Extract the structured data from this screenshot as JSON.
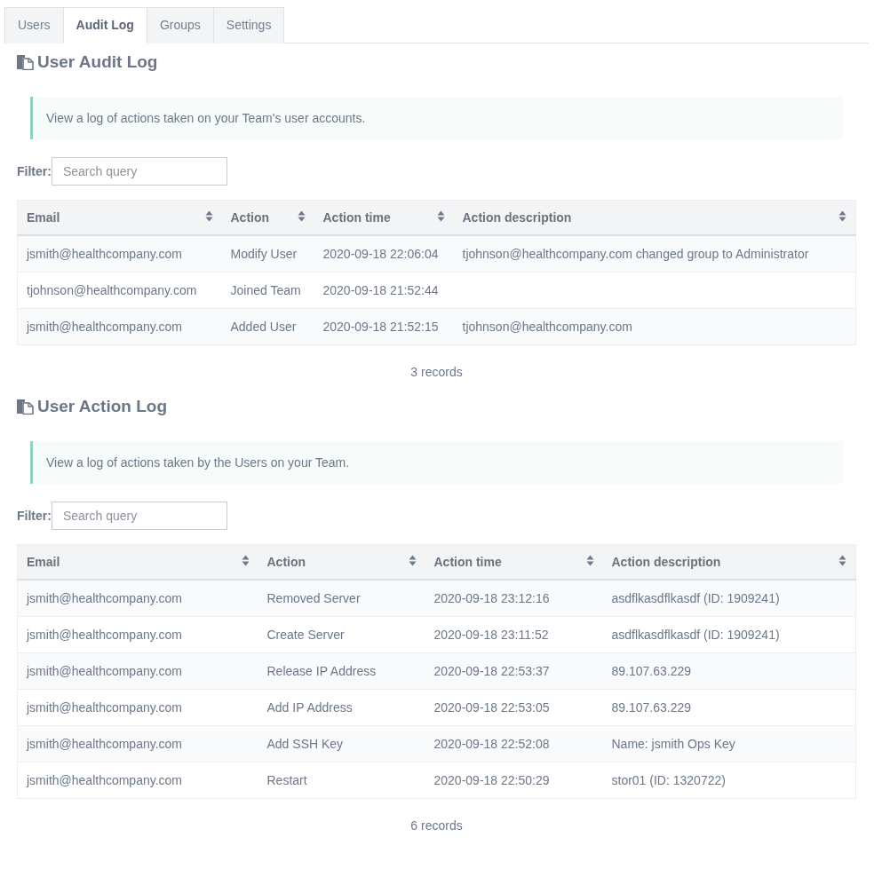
{
  "tabs": [
    {
      "label": "Users",
      "selected": false
    },
    {
      "label": "Audit Log",
      "selected": true
    },
    {
      "label": "Groups",
      "selected": false
    },
    {
      "label": "Settings",
      "selected": false
    }
  ],
  "sections": [
    {
      "title": "User Audit Log",
      "info": "View a log of actions taken on your Team's user accounts.",
      "filter": {
        "label": "Filter:",
        "placeholder": "Search query"
      },
      "table": {
        "columns": [
          "Email",
          "Action",
          "Action time",
          "Action description"
        ],
        "rows": [
          {
            "cells": [
              "jsmith@healthcompany.com",
              "Modify User",
              "2020-09-18 22:06:04",
              "tjohnson@healthcompany.com changed group to Administrator"
            ]
          },
          {
            "cells": [
              "tjohnson@healthcompany.com",
              "Joined Team",
              "2020-09-18 21:52:44"
            ]
          },
          {
            "cells": [
              "jsmith@healthcompany.com",
              "Added User",
              "2020-09-18 21:52:15",
              "tjohnson@healthcompany.com"
            ]
          }
        ]
      },
      "record_count": "3 records"
    },
    {
      "title": "User Action Log",
      "info": "View a log of actions taken by the Users on your Team.",
      "filter": {
        "label": "Filter:",
        "placeholder": "Search query"
      },
      "table": {
        "columns": [
          "Email",
          "Action",
          "Action time",
          "Action description"
        ],
        "rows": [
          {
            "cells": [
              "jsmith@healthcompany.com",
              "Removed Server",
              "2020-09-18 23:12:16",
              "asdflkasdflkasdf (ID: 1909241)"
            ]
          },
          {
            "cells": [
              "jsmith@healthcompany.com",
              "Create Server",
              "2020-09-18 23:11:52",
              "asdflkasdflkasdf (ID: 1909241)"
            ]
          },
          {
            "cells": [
              "jsmith@healthcompany.com",
              "Release IP Address",
              "2020-09-18 22:53:37",
              "89.107.63.229"
            ]
          },
          {
            "cells": [
              "jsmith@healthcompany.com",
              "Add IP Address",
              "2020-09-18 22:53:05",
              "89.107.63.229"
            ]
          },
          {
            "cells": [
              "jsmith@healthcompany.com",
              "Add SSH Key",
              "2020-09-18 22:52:08",
              "Name: jsmith Ops Key"
            ]
          },
          {
            "cells": [
              "jsmith@healthcompany.com",
              "Restart",
              "2020-09-18 22:50:29",
              "stor01 (ID: 1320722)"
            ]
          }
        ]
      },
      "record_count": "6 records"
    }
  ]
}
